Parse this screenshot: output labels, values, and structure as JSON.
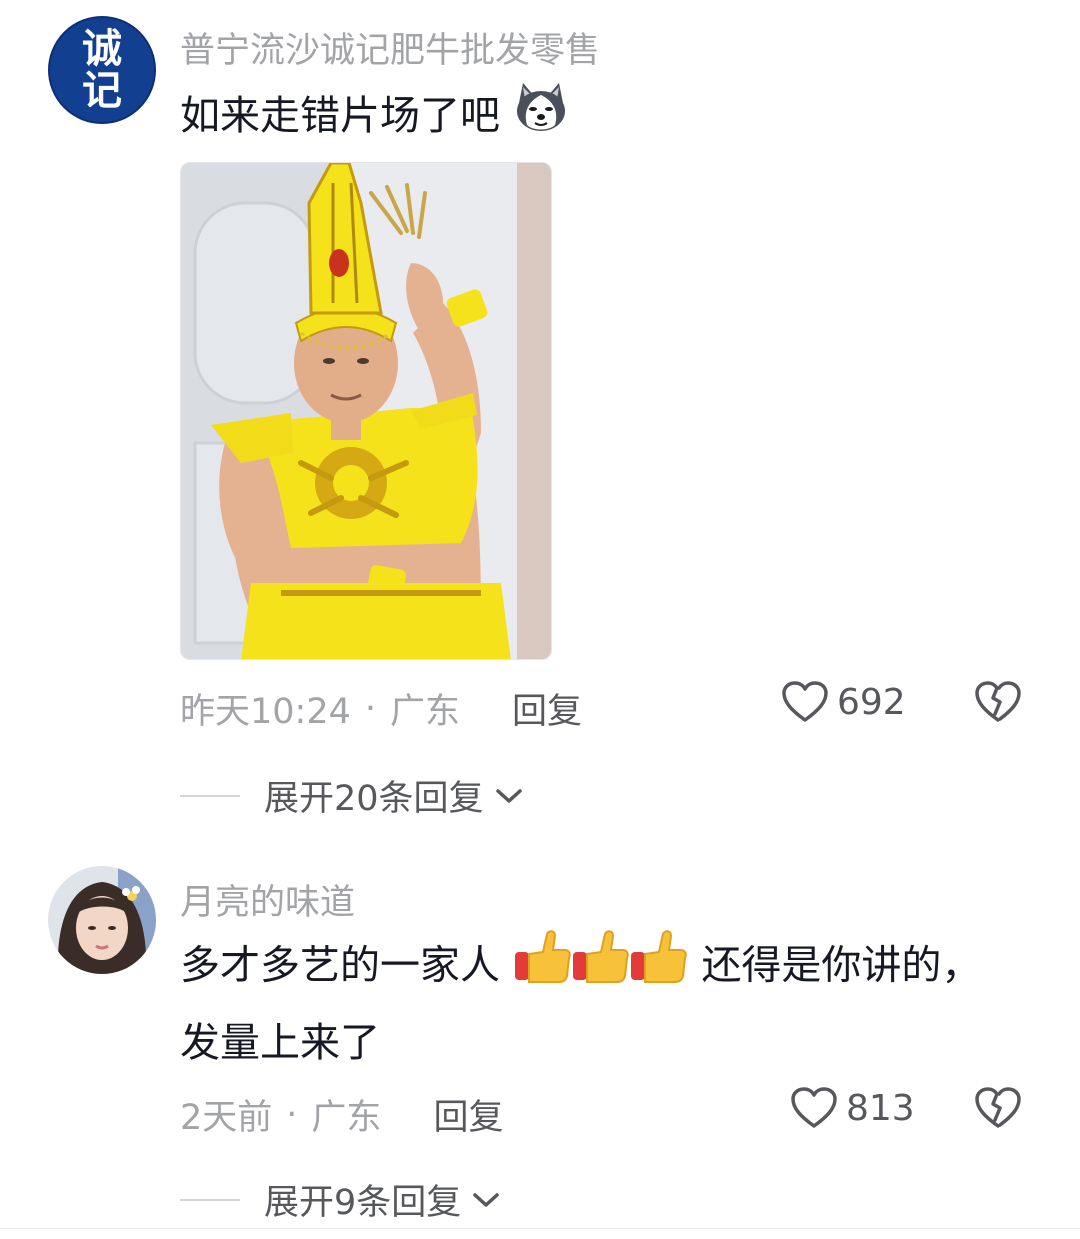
{
  "comments": [
    {
      "avatar_text": [
        "诚",
        "记"
      ],
      "username": "普宁流沙诚记肥牛批发零售",
      "content": "如来走错片场了吧",
      "emoji": "husky-dog-emoji",
      "has_image": true,
      "time": "昨天10:24",
      "separator": "·",
      "location": "广东",
      "reply_label": "回复",
      "likes": "692",
      "expand_label": "展开20条回复"
    },
    {
      "username": "月亮的味道",
      "content_part1": "多才多艺的一家人",
      "emoji": "thumbs-up-emoji",
      "content_part2": "还得是你讲的，",
      "content_line2": "发量上来了",
      "time": "2天前",
      "separator": "·",
      "location": "广东",
      "reply_label": "回复",
      "likes": "813",
      "expand_label": "展开9条回复"
    }
  ],
  "colors": {
    "text_primary": "#161823",
    "text_secondary": "#a3a4a8",
    "text_action": "#57585c",
    "logo_bg": "#123f8f",
    "costume_yellow": "#f5e21b"
  }
}
